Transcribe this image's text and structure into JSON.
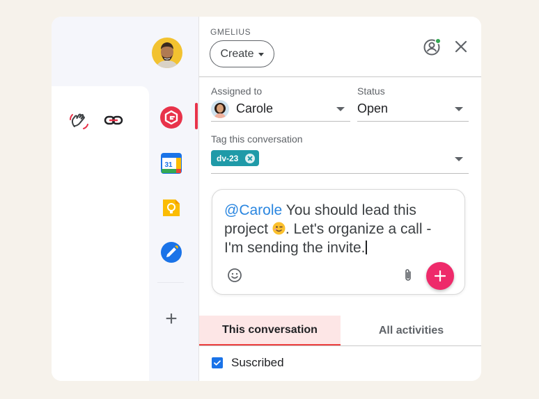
{
  "header": {
    "brand": "GMELIUS",
    "create_label": "Create"
  },
  "rail": {
    "apps": [
      {
        "name": "gmelius-app-icon"
      },
      {
        "name": "google-calendar-icon",
        "label": "31"
      },
      {
        "name": "google-keep-icon"
      },
      {
        "name": "google-tasks-icon"
      }
    ],
    "add_label": "+"
  },
  "fields": {
    "assigned_label": "Assigned to",
    "assigned_value": "Carole",
    "status_label": "Status",
    "status_value": "Open",
    "tag_label": "Tag this conversation",
    "tag_chip": "dv-23"
  },
  "composer": {
    "mention": "@Carole",
    "text_part1": " You should lead this project ",
    "text_part2": ". Let's organize a call - I'm sending the invite."
  },
  "tabs": [
    {
      "label": "This conversation",
      "active": true
    },
    {
      "label": "All activities",
      "active": false
    }
  ],
  "subscription": {
    "label": "Suscribed",
    "checked": true
  },
  "colors": {
    "accent": "#ee2a6a",
    "chip": "#1f9aa8",
    "mention": "#2a86e0",
    "tab_active_bg": "#fde6e6",
    "checkbox": "#1a73e8"
  }
}
